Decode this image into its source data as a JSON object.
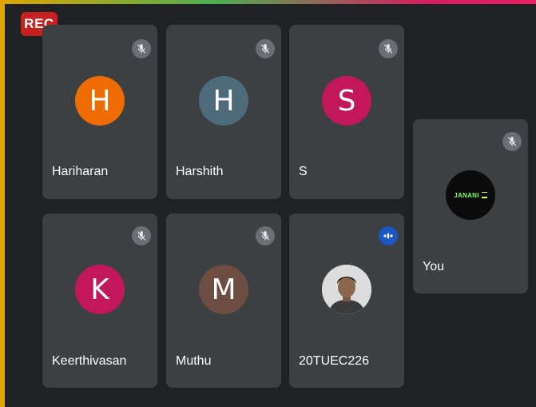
{
  "recording": {
    "label": "REC"
  },
  "participants": [
    {
      "name": "Hariharan",
      "initial": "H",
      "color": "#ef6c00",
      "muted": true
    },
    {
      "name": "Harshith",
      "initial": "H",
      "color": "#4e6b7c",
      "muted": true
    },
    {
      "name": "S",
      "initial": "S",
      "color": "#c2185b",
      "muted": true
    },
    {
      "name": "Keerthivasan",
      "initial": "K",
      "color": "#c2185b",
      "muted": true
    },
    {
      "name": "Muthu",
      "initial": "M",
      "color": "#6d4c41",
      "muted": true
    },
    {
      "name": "20TUEC226",
      "initial": "",
      "color": "#e0e0e0",
      "muted": false,
      "speaking": true
    }
  ],
  "self": {
    "name": "You",
    "avatar_text": "JANANI",
    "muted": true
  },
  "icons": {
    "muted": "mic-off-icon",
    "speaking": "speaking-indicator-icon"
  }
}
